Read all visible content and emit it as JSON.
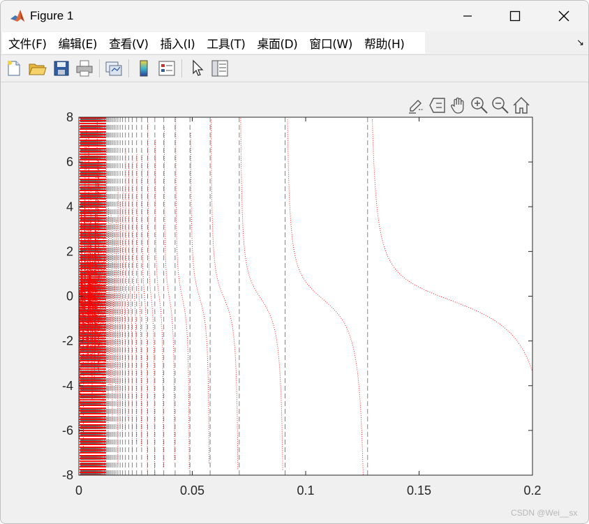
{
  "window": {
    "title": "Figure 1",
    "minimize_glyph": "—",
    "maximize_glyph": "☐",
    "close_glyph": "✕"
  },
  "menu": {
    "items": [
      {
        "label": "文件(F)",
        "key": "file"
      },
      {
        "label": "编辑(E)",
        "key": "edit"
      },
      {
        "label": "查看(V)",
        "key": "view"
      },
      {
        "label": "插入(I)",
        "key": "insert"
      },
      {
        "label": "工具(T)",
        "key": "tools"
      },
      {
        "label": "桌面(D)",
        "key": "desktop"
      },
      {
        "label": "窗口(W)",
        "key": "window"
      },
      {
        "label": "帮助(H)",
        "key": "help"
      }
    ],
    "dock_glyph": "↘"
  },
  "toolbar": {
    "icons": [
      "new-figure-icon",
      "open-file-icon",
      "save-icon",
      "print-icon",
      "link-plot-icon",
      "colorbar-icon",
      "legend-icon",
      "edit-plot-icon",
      "property-inspector-icon"
    ]
  },
  "axes_toolbar": {
    "icons": [
      "brush-icon",
      "data-tips-icon",
      "pan-icon",
      "zoom-in-icon",
      "zoom-out-icon",
      "home-icon"
    ]
  },
  "colors": {
    "curve": "#ff0000",
    "asymptote": "#666666",
    "axes": "#262626"
  },
  "chart_data": {
    "type": "line",
    "function": "tan(1/x)",
    "xlim": [
      0,
      0.2
    ],
    "ylim": [
      -8,
      8
    ],
    "xticks": [
      "0",
      "0.05",
      "0.1",
      "0.15",
      "0.2"
    ],
    "yticks": [
      "8",
      "6",
      "4",
      "2",
      "0",
      "-2",
      "-4",
      "-6",
      "-8"
    ],
    "series": [
      {
        "style": "dotted",
        "color": "#ff0000"
      }
    ],
    "asymptote_style": "dashed",
    "grid": false
  },
  "watermark": "CSDN @Wei__sx"
}
